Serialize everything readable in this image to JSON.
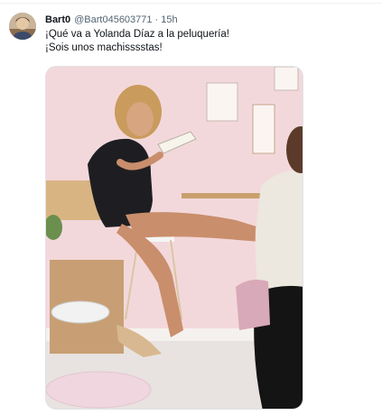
{
  "tweet": {
    "display_name": "Bart0",
    "handle": "@Bart045603771",
    "separator": "·",
    "time": "15h",
    "text_lines": [
      "¡Qué va a Yolanda Díaz a la peluquería!",
      "¡Sois unos machisssstas!"
    ]
  },
  "icons": {
    "avatar": "user-avatar",
    "media": "tweet-photo"
  },
  "colors": {
    "text_primary": "#0f1419",
    "text_secondary": "#536471",
    "border": "#dfe3e6",
    "wall_pink": "#f4d9dc"
  }
}
